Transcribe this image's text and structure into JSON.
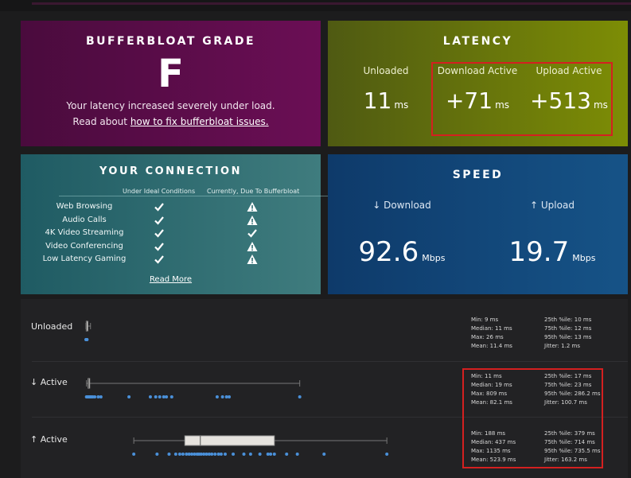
{
  "grade": {
    "title": "BUFFERBLOAT GRADE",
    "letter": "F",
    "desc": "Your latency increased severely under load.",
    "read_prefix": "Read about ",
    "read_link": "how to fix bufferbloat issues."
  },
  "latency": {
    "title": "LATENCY",
    "unloaded": {
      "label": "Unloaded",
      "value": "11",
      "unit": "ms"
    },
    "download": {
      "label": "Download Active",
      "value": "+71",
      "unit": "ms"
    },
    "upload": {
      "label": "Upload Active",
      "value": "+513",
      "unit": "ms"
    }
  },
  "connection": {
    "title": "YOUR CONNECTION",
    "col_ideal": "Under Ideal Conditions",
    "col_current": "Currently, Due To Bufferbloat",
    "rows": [
      {
        "name": "Web Browsing",
        "ideal": "check",
        "current": "warning"
      },
      {
        "name": "Audio Calls",
        "ideal": "check",
        "current": "warning"
      },
      {
        "name": "4K Video Streaming",
        "ideal": "check",
        "current": "check"
      },
      {
        "name": "Video Conferencing",
        "ideal": "check",
        "current": "warning"
      },
      {
        "name": "Low Latency Gaming",
        "ideal": "check",
        "current": "warning"
      }
    ],
    "read_more": "Read More"
  },
  "speed": {
    "title": "SPEED",
    "download": {
      "label": "↓ Download",
      "value": "92.6",
      "unit": "Mbps"
    },
    "upload": {
      "label": "↑ Upload",
      "value": "19.7",
      "unit": "Mbps"
    }
  },
  "colors": {
    "accent_point": "#4a90d9",
    "highlight": "#d42020"
  },
  "chart_data": {
    "type": "boxplot",
    "rows": [
      {
        "label": "Unloaded",
        "stats_left": [
          "Min: 9 ms",
          "Median: 11 ms",
          "Max: 26 ms",
          "Mean: 11.4 ms"
        ],
        "stats_right": [
          "25th %ile: 10 ms",
          "75th %ile: 12 ms",
          "95th %ile: 13 ms",
          "Jitter: 1.2 ms"
        ],
        "min": 9,
        "q1": 10,
        "median": 11,
        "q3": 12,
        "max": 26,
        "points": [
          9,
          10,
          11,
          12,
          13
        ]
      },
      {
        "label": "↓ Active",
        "stats_left": [
          "Min: 11 ms",
          "Median: 19 ms",
          "Max: 809 ms",
          "Mean: 82.1 ms"
        ],
        "stats_right": [
          "25th %ile: 17 ms",
          "75th %ile: 23 ms",
          "95th %ile: 286.2 ms",
          "Jitter: 100.7 ms"
        ],
        "min": 11,
        "q1": 17,
        "median": 19,
        "q3": 23,
        "max": 809,
        "points": [
          11,
          14,
          17,
          19,
          21,
          23,
          26,
          30,
          35,
          42,
          55,
          65,
          170,
          250,
          270,
          285,
          300,
          310,
          330,
          500,
          520,
          535,
          545,
          809
        ]
      },
      {
        "label": "↑ Active",
        "stats_left": [
          "Min: 188 ms",
          "Median: 437 ms",
          "Max: 1135 ms",
          "Mean: 523.9 ms"
        ],
        "stats_right": [
          "25th %ile: 379 ms",
          "75th %ile: 714 ms",
          "95th %ile: 735.5 ms",
          "Jitter: 163.2 ms"
        ],
        "min": 188,
        "q1": 379,
        "median": 437,
        "q3": 714,
        "max": 1135,
        "points": [
          188,
          275,
          320,
          345,
          360,
          372,
          385,
          395,
          405,
          415,
          425,
          432,
          440,
          450,
          460,
          470,
          480,
          492,
          505,
          515,
          530,
          560,
          600,
          625,
          660,
          690,
          700,
          714,
          760,
          800,
          900,
          1135
        ]
      }
    ]
  }
}
